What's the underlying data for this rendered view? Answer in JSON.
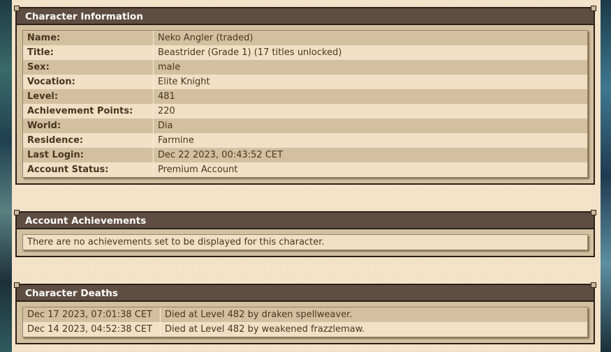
{
  "character_info": {
    "title": "Character Information",
    "rows": [
      {
        "label": "Name:",
        "value": "Neko Angler (traded)"
      },
      {
        "label": "Title:",
        "value": "Beastrider (Grade 1) (17 titles unlocked)"
      },
      {
        "label": "Sex:",
        "value": "male"
      },
      {
        "label": "Vocation:",
        "value": "Elite Knight"
      },
      {
        "label": "Level:",
        "value": "481"
      },
      {
        "label": "Achievement Points:",
        "value": "220"
      },
      {
        "label": "World:",
        "value": "Dia"
      },
      {
        "label": "Residence:",
        "value": "Farmine"
      },
      {
        "label": "Last Login:",
        "value": "Dec 22 2023, 00:43:52 CET"
      },
      {
        "label": "Account Status:",
        "value": "Premium Account"
      }
    ]
  },
  "account_achievements": {
    "title": "Account Achievements",
    "message": "There are no achievements set to be displayed for this character."
  },
  "character_deaths": {
    "title": "Character Deaths",
    "rows": [
      {
        "date": "Dec 17 2023, 07:01:38 CET",
        "description": "Died at Level 482 by draken spellweaver."
      },
      {
        "date": "Dec 14 2023, 04:52:38 CET",
        "description": "Died at Level 482 by weakened frazzlemaw."
      }
    ]
  },
  "colors": {
    "header_bg": "#5f4d41",
    "row_dark": "#d4c0a1",
    "row_light": "#f1e0c6",
    "text": "#4a3520"
  }
}
